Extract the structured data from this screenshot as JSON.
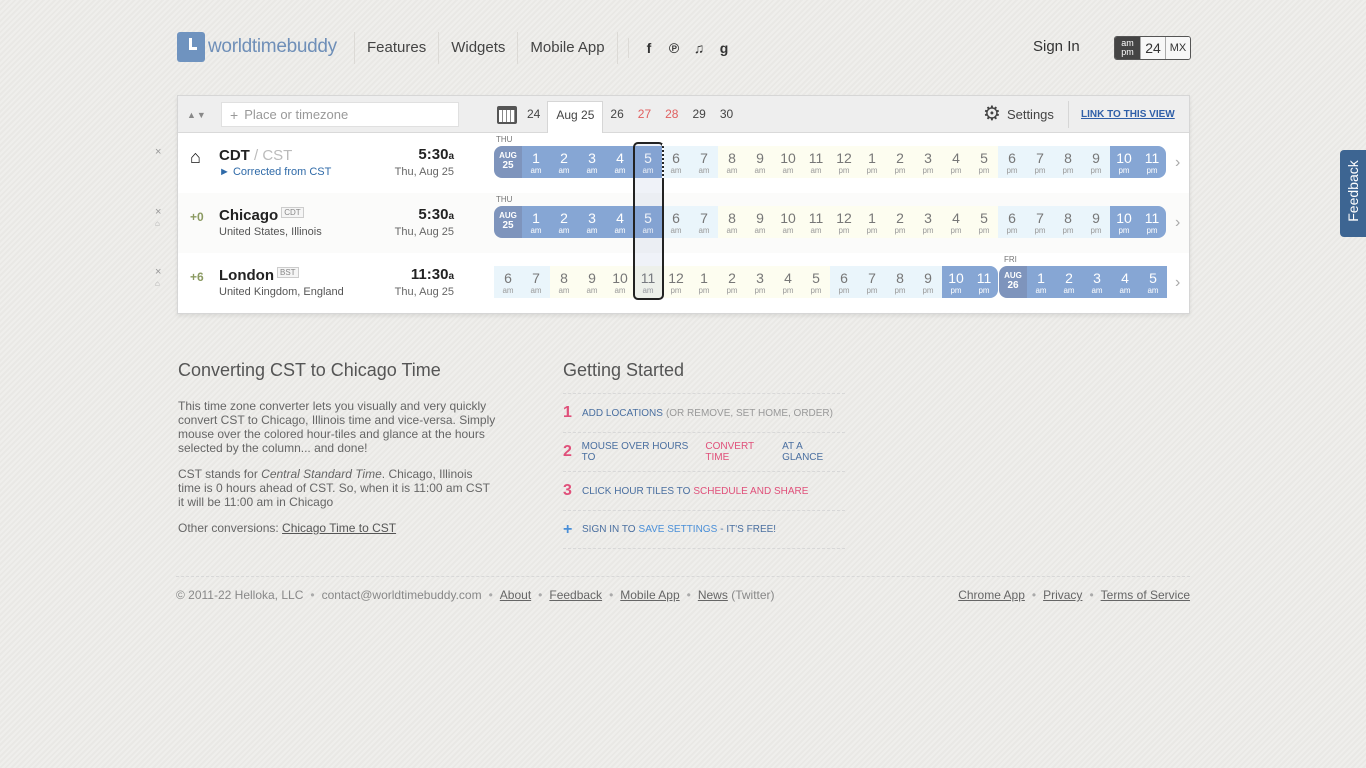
{
  "header": {
    "logo_text": "worldtimebuddy",
    "nav": [
      "Features",
      "Widgets",
      "Mobile App"
    ],
    "social_icons": [
      "facebook-icon",
      "pinterest-icon",
      "twitter-icon",
      "google-plus-icon"
    ],
    "sign_in": "Sign In",
    "time_format": {
      "ampm_top": "am",
      "ampm_bottom": "pm",
      "h24": "24",
      "mx": "MX",
      "selected": "am/pm"
    }
  },
  "toolbar": {
    "search_placeholder": "Place or timezone",
    "dates": [
      "24",
      "Aug 25",
      "26",
      "27",
      "28",
      "29",
      "30"
    ],
    "selected_date": "Aug 25",
    "weekend_dates": [
      "27",
      "28"
    ],
    "settings": "Settings",
    "link_view": "LINK TO THIS VIEW"
  },
  "rows": [
    {
      "city": "CDT",
      "alt": " / CST",
      "sub": "► Corrected from CST",
      "time": "5:30",
      "suffix": "a",
      "date": "Thu, Aug 25",
      "day_label": "THU",
      "start_month": "AUG",
      "start_day": "25",
      "hours": [
        "1",
        "2",
        "3",
        "4",
        "5",
        "6",
        "7",
        "8",
        "9",
        "10",
        "11",
        "12",
        "1",
        "2",
        "3",
        "4",
        "5",
        "6",
        "7",
        "8",
        "9",
        "10",
        "11"
      ],
      "ampm": [
        "am",
        "am",
        "am",
        "am",
        "am",
        "am",
        "am",
        "am",
        "am",
        "am",
        "am",
        "pm",
        "pm",
        "pm",
        "pm",
        "pm",
        "pm",
        "pm",
        "pm",
        "pm",
        "pm",
        "pm",
        "pm"
      ]
    },
    {
      "offset": "+0",
      "city": "Chicago",
      "badge": "CDT",
      "sub": "United States, Illinois",
      "time": "5:30",
      "suffix": "a",
      "date": "Thu, Aug 25",
      "day_label": "THU",
      "start_month": "AUG",
      "start_day": "25",
      "hours": [
        "1",
        "2",
        "3",
        "4",
        "5",
        "6",
        "7",
        "8",
        "9",
        "10",
        "11",
        "12",
        "1",
        "2",
        "3",
        "4",
        "5",
        "6",
        "7",
        "8",
        "9",
        "10",
        "11"
      ],
      "ampm": [
        "am",
        "am",
        "am",
        "am",
        "am",
        "am",
        "am",
        "am",
        "am",
        "am",
        "am",
        "pm",
        "pm",
        "pm",
        "pm",
        "pm",
        "pm",
        "pm",
        "pm",
        "pm",
        "pm",
        "pm",
        "pm"
      ]
    },
    {
      "offset": "+6",
      "city": "London",
      "badge": "BST",
      "sub": "United Kingdom, England",
      "time": "11:30",
      "suffix": "a",
      "date": "Thu, Aug 25",
      "day_label": "FRI",
      "start_month": "AUG",
      "start_day": "26",
      "hours_before": [
        "6",
        "7",
        "8",
        "9",
        "10",
        "11",
        "12",
        "1",
        "2",
        "3",
        "4",
        "5",
        "6",
        "7",
        "8",
        "9",
        "10",
        "11"
      ],
      "ampm_before": [
        "am",
        "am",
        "am",
        "am",
        "am",
        "am",
        "pm",
        "pm",
        "pm",
        "pm",
        "pm",
        "pm",
        "pm",
        "pm",
        "pm",
        "pm",
        "pm",
        "pm"
      ],
      "hours_after": [
        "1",
        "2",
        "3",
        "4",
        "5"
      ],
      "ampm_after": [
        "am",
        "am",
        "am",
        "am",
        "am"
      ]
    }
  ],
  "converting": {
    "title": "Converting CST to Chicago Time",
    "p1": "This time zone converter lets you visually and very quickly convert CST to Chicago, Illinois time and vice-versa. Simply mouse over the colored hour-tiles and glance at the hours selected by the column... and done!",
    "p2_a": "CST stands for ",
    "p2_em": "Central Standard Time",
    "p2_b": ". Chicago, Illinois time is 0 hours ahead of CST. So, when it is 11:00 am CST it will be 11:00 am in Chicago",
    "p3_label": "Other conversions: ",
    "p3_link": "Chicago Time to CST"
  },
  "getting_started": {
    "title": "Getting Started",
    "steps": [
      {
        "num": "1",
        "a": "ADD LOCATIONS",
        "muted": "(OR REMOVE, SET HOME, ORDER)"
      },
      {
        "num": "2",
        "a": "MOUSE OVER HOURS TO",
        "hl": "CONVERT TIME",
        "b": "AT A GLANCE"
      },
      {
        "num": "3",
        "a": "CLICK HOUR TILES TO",
        "hl": "SCHEDULE AND SHARE"
      },
      {
        "num": "+",
        "a": "SIGN IN TO",
        "hl": "SAVE SETTINGS",
        "b": "- IT'S FREE!"
      }
    ]
  },
  "footer": {
    "copyright": "© 2011-22 Helloka, LLC",
    "email": "contact@worldtimebuddy.com",
    "links_left": [
      "About",
      "Feedback",
      "Mobile App",
      "News"
    ],
    "twitter_note": "(Twitter)",
    "links_right": [
      "Chrome App",
      "Privacy",
      "Terms of Service"
    ]
  },
  "feedback_tab": "Feedback",
  "colors": {
    "accent": "#6f93bf",
    "night": "#86a6d4",
    "pink": "#e0507a",
    "feedback": "#3d6592"
  }
}
